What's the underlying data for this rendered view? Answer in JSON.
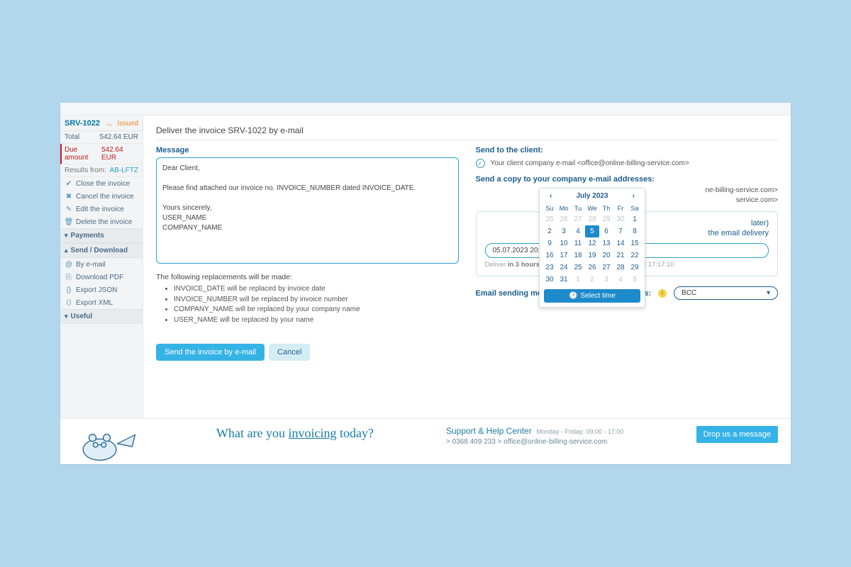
{
  "sidebar": {
    "invoice_id": "SRV-1022",
    "status": "Issued",
    "rows": {
      "total_label": "Total",
      "total_value": "542.64 EUR",
      "due_label": "Due amount",
      "due_value": "542.64 EUR",
      "results_label": "Results from:",
      "results_value": "AB-LFTZ"
    },
    "actions": {
      "close": "Close the invoice",
      "cancel": "Cancel the invoice",
      "edit": "Edit the invoice",
      "delete": "Delete the invoice"
    },
    "sections": {
      "payments": "Payments",
      "send": "Send / Download",
      "useful": "Useful"
    },
    "send_items": {
      "email": "By e-mail",
      "pdf": "Download PDF",
      "json": "Export JSON",
      "xml": "Export XML"
    }
  },
  "page": {
    "title": "Deliver the invoice SRV-1022 by e-mail",
    "message_label": "Message",
    "message_body": "Dear Client,\n\nPlease find attached our invoice no. INVOICE_NUMBER dated INVOICE_DATE.\n\nYours sincerely,\nUSER_NAME\nCOMPANY_NAME",
    "replacements_title": "The following replacements will be made:",
    "replacements": [
      "INVOICE_DATE will be replaced by invoice date",
      "INVOICE_NUMBER will be replaced by invoice number",
      "COMPANY_NAME will be replaced by your company name",
      "USER_NAME will be replaced by your name"
    ],
    "send_to_label": "Send to the client:",
    "send_to_line": "Your client company e-mail <office@online-billing-service.com>",
    "copies_label": "Send a copy to your company e-mail addresses:",
    "copy1_suffix": "ne-billing-service.com>",
    "copy2_suffix": "service.com>",
    "later_title_suffix": "later)",
    "later_desc_suffix": "the email delivery",
    "datetime_value": "05.07.2023 20:13",
    "deliver_prefix": "Deliver ",
    "deliver_bold": "in 3 hours",
    "deliver_suffix": ". Current date and time: 05.07.2023 17:17:10",
    "method_label": "Email sending method to multiple destinations:",
    "method_value": "BCC",
    "btn_send": "Send the invoice by e-mail",
    "btn_cancel": "Cancel"
  },
  "calendar": {
    "month": "July 2023",
    "dow": [
      "Su",
      "Mo",
      "Tu",
      "We",
      "Th",
      "Fr",
      "Sa"
    ],
    "weeks": [
      [
        {
          "d": "25",
          "m": 1
        },
        {
          "d": "26",
          "m": 1
        },
        {
          "d": "27",
          "m": 1
        },
        {
          "d": "28",
          "m": 1
        },
        {
          "d": "29",
          "m": 1
        },
        {
          "d": "30",
          "m": 1
        },
        {
          "d": "1"
        }
      ],
      [
        {
          "d": "2"
        },
        {
          "d": "3"
        },
        {
          "d": "4"
        },
        {
          "d": "5",
          "sel": 1
        },
        {
          "d": "6"
        },
        {
          "d": "7"
        },
        {
          "d": "8"
        }
      ],
      [
        {
          "d": "9"
        },
        {
          "d": "10"
        },
        {
          "d": "11"
        },
        {
          "d": "12"
        },
        {
          "d": "13"
        },
        {
          "d": "14"
        },
        {
          "d": "15"
        }
      ],
      [
        {
          "d": "16"
        },
        {
          "d": "17"
        },
        {
          "d": "18"
        },
        {
          "d": "19"
        },
        {
          "d": "20"
        },
        {
          "d": "21"
        },
        {
          "d": "22"
        }
      ],
      [
        {
          "d": "23"
        },
        {
          "d": "24"
        },
        {
          "d": "25"
        },
        {
          "d": "26"
        },
        {
          "d": "27"
        },
        {
          "d": "28"
        },
        {
          "d": "29"
        }
      ],
      [
        {
          "d": "30"
        },
        {
          "d": "31"
        },
        {
          "d": "1",
          "m": 1
        },
        {
          "d": "2",
          "m": 1
        },
        {
          "d": "3",
          "m": 1
        },
        {
          "d": "4",
          "m": 1
        },
        {
          "d": "5",
          "m": 1
        }
      ]
    ],
    "select_time": "Select time"
  },
  "footer": {
    "tagline_pre": "What are you ",
    "tagline_u": "invoicing",
    "tagline_post": " today?",
    "help": "Support & Help Center",
    "hours": "Monday - Friday: 09:00 - 17:00",
    "phone": "0368 409 233",
    "email": "office@online-billing-service.com",
    "drop": "Drop us a message"
  }
}
